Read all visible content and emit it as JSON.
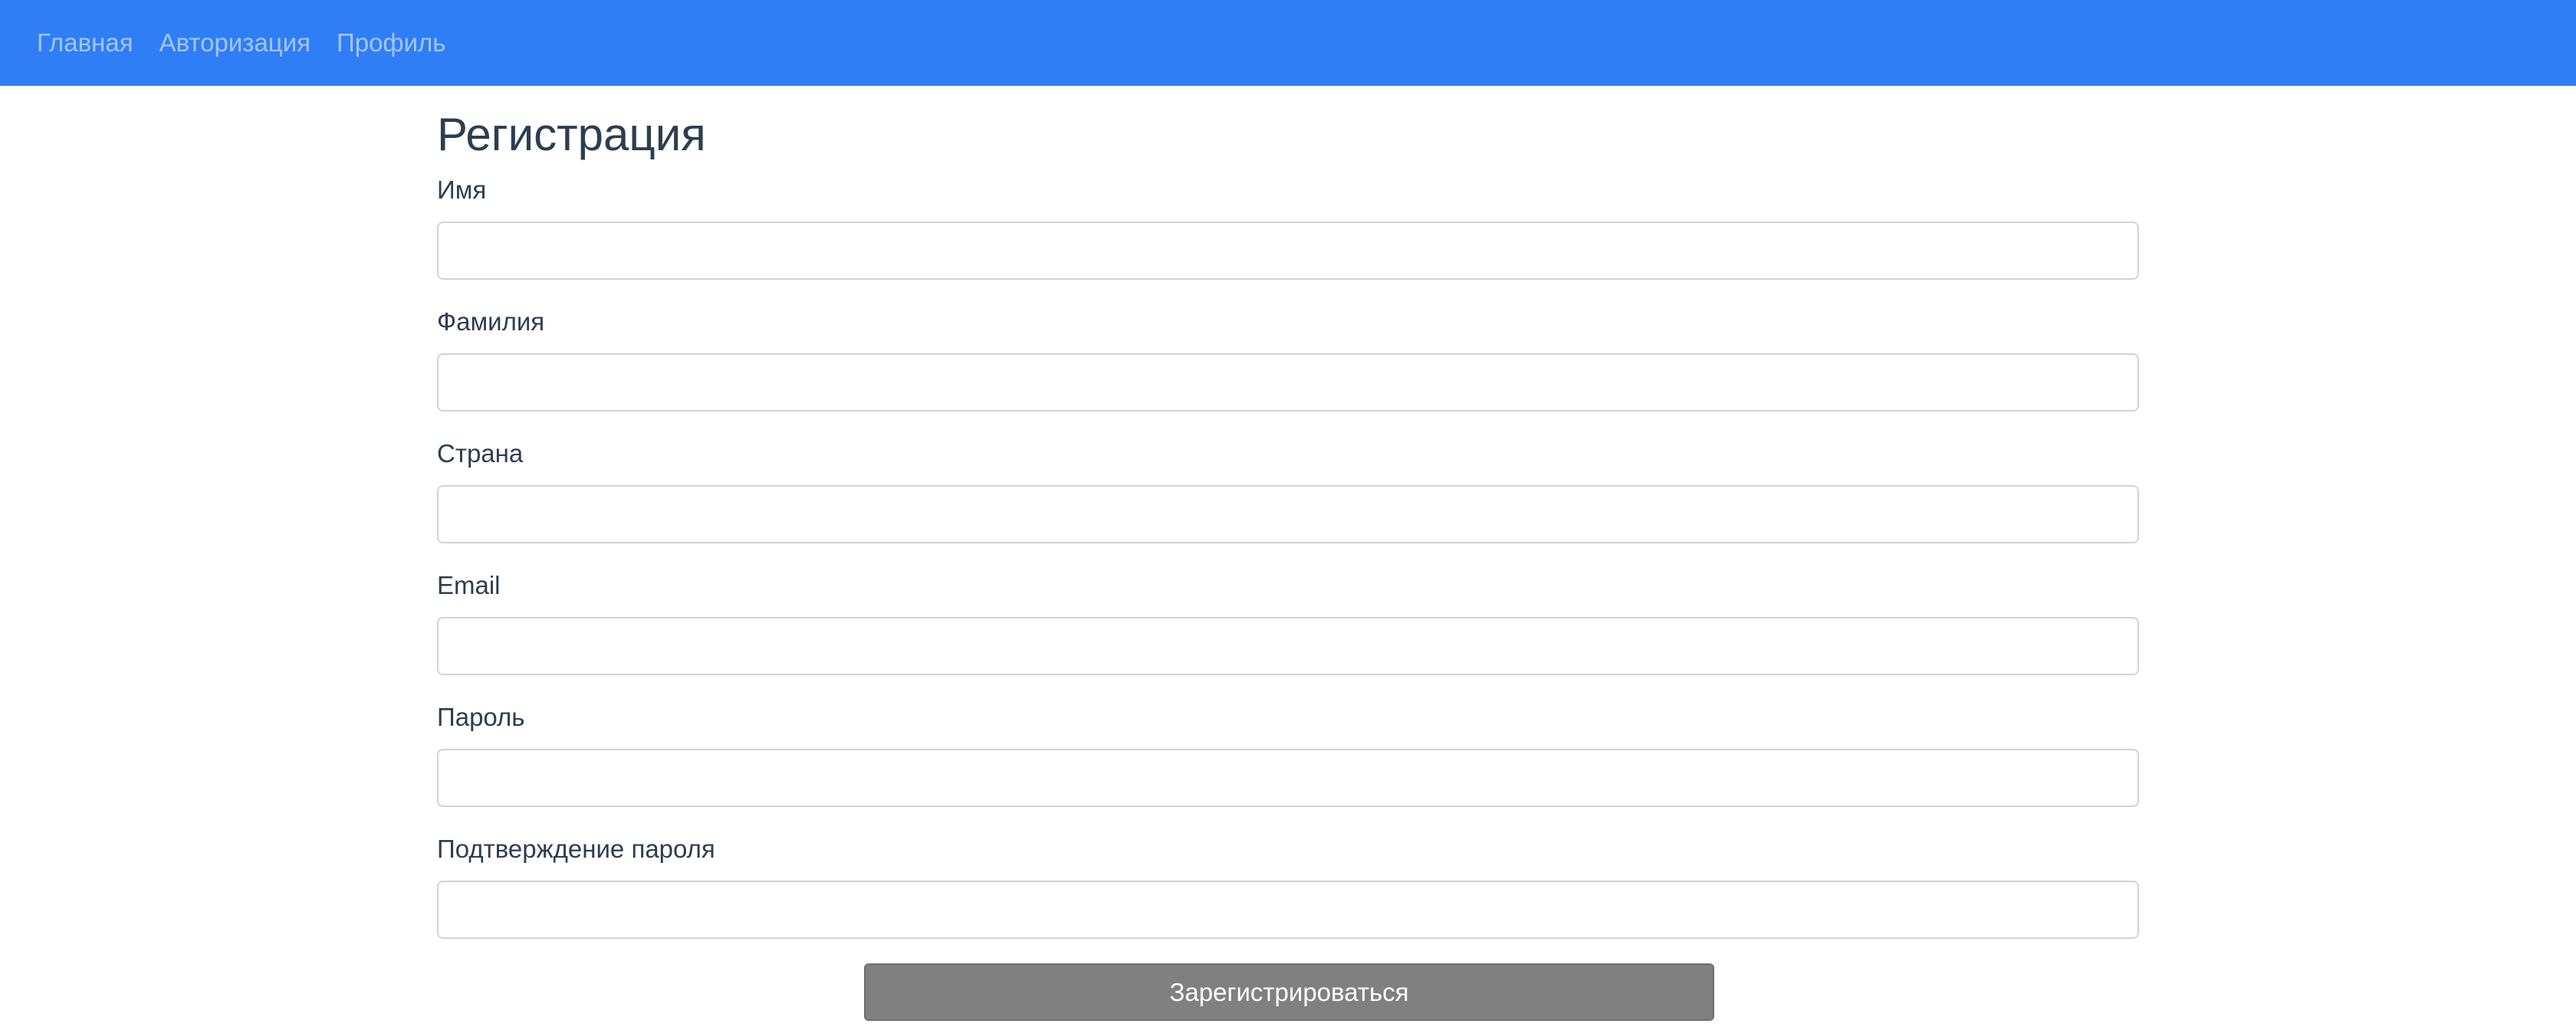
{
  "nav": {
    "items": [
      {
        "label": "Главная"
      },
      {
        "label": "Авторизация"
      },
      {
        "label": "Профиль"
      }
    ]
  },
  "form": {
    "title": "Регистрация",
    "fields": [
      {
        "label": "Имя",
        "value": "",
        "placeholder": ""
      },
      {
        "label": "Фамилия",
        "value": "",
        "placeholder": ""
      },
      {
        "label": "Страна",
        "value": "",
        "placeholder": ""
      },
      {
        "label": "Email",
        "value": "",
        "placeholder": ""
      },
      {
        "label": "Пароль",
        "value": "",
        "placeholder": ""
      },
      {
        "label": "Подтверждение пароля",
        "value": "",
        "placeholder": ""
      }
    ],
    "submit_label": "Зарегистрироваться"
  },
  "colors": {
    "navbar": "#2f7ef5",
    "button": "#808080",
    "text": "#2c3e50"
  }
}
